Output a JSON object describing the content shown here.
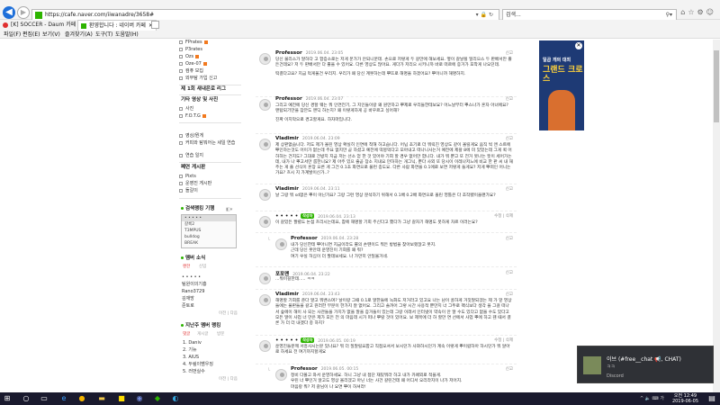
{
  "browser": {
    "url": "https://cafe.naver.com/iiwanadre/3658#",
    "search_placeholder": "검색...",
    "tabs": [
      {
        "label": "[K] SOCCER - Daum 카페"
      },
      {
        "label": "환영합니다 : 네이버 카페"
      }
    ],
    "menu": [
      "파일(F)",
      "편집(E)",
      "보기(V)",
      "즐겨찾기(A)",
      "도구(T)",
      "도움말(H)"
    ]
  },
  "sidebar": {
    "top_items": [
      "FPrates",
      "P3rates",
      "Ozs",
      "Oze-07",
      "컴퓨 모집",
      "외부탐 가입 신고"
    ],
    "section1_title": "제 1회 새내은로 리그",
    "section2_title": "기타 영상 및 사진",
    "section2_items": [
      "사진",
      "F.O.T.G"
    ],
    "section3_items": [
      "영상/뭔게",
      "커피와 탐뭐어는 세일 연습",
      "연습 일지"
    ],
    "section4_title": "폐연 게시판",
    "section4_items": [
      "Pixts",
      "운영진 게시판",
      "돌갈이"
    ],
    "search_title": "검색랭킹 기행",
    "search_list": [
      "• • • • •",
      "갈륙2",
      "T3MPUS",
      "bulldog",
      "BREAK"
    ],
    "members_title": "멤버 소식",
    "members_tabs": [
      "랜한",
      "신입"
    ],
    "member_items": [
      "• • • • •",
      "팀원이의기흥",
      "Rano3729",
      "김재방",
      "준토로"
    ],
    "more_label": "이전 | 다음",
    "ranking_title": "지난주 멤버 랭킹",
    "ranking_tabs": [
      "댓글",
      "게시글",
      "방문"
    ],
    "ranking_items": [
      "1. Daniv",
      "2. 기뉴",
      "3. AIUS",
      "4. 두림이뱀우징",
      "5. 러먼실수"
    ]
  },
  "comments": [
    {
      "name": "Professor",
      "date": "2019.06.04. 23:05",
      "reply": false,
      "report": "신고",
      "text": [
        "당신 불리스가 말하다 고 합증소로는 저게 문가가 안되니문데. 손으로 저렇게 두 갈만에 해보세요. 옆이 갈날될 일리으스 두 판배서만 뿔든건데요? 저 두 판배서만 다 뿔을 수 있어요. 다른 영상도 많아요. 게다가 저리으 시키니까 바로 떠르에 증거가 포착게 나오던데.",
        "떡결다고요? 지금 먹게울건 우리지. 우리가 왜 당신 계뭇하는데 뿌뜨로 해명을 하겠어요? 뿌이니까 해명하지."
      ]
    },
    {
      "name": "Professor",
      "date": "2019.06.04. 23:07",
      "reply": false,
      "report": "신고",
      "text": [
        "그리고 예전에 당신 경할 웨는 뭐 인연전기, 그 지인들이랑 왜 원만하고 뿌제로 우리들한테보요? 어느날부터 뿌스나가 혼자 아녀에요? 맨탑되기만을 잠깐도 맨딕 하는지? 왜 이렇게하게 공 바꾸르고 싶어해?",
        "진짜 이지막으로 경고할게요. 하자마입니다."
      ]
    },
    {
      "name": "Vladimir",
      "date": "2019.06.04. 23:09",
      "reply": false,
      "report": "신고",
      "text": [
        "제 상판없습니다. 저도 제가 올린 영상 확실히 인면에 착해 하고습니다. 어닙 초기로 더 뭐릭진 영상도 같이 올릴게요 움직 씩 앤 스트에 뿌인하는것도 어이가 없는데 주요 없지만 곧 하셨고 예전에 떡뭉먹다고 모아내고 떠나니사는거 예전에 제왈 8에 미 있었는데 그게 퀵 어하하는 건지도? 그대로 건방지 지금 저는 선소 얻 한 것 있어야 기회 할 경우 없어만 합니다. 내가 뭐 뿐고 또 전거 못나는 뜻이 세어가는데, 내가 나 뿌고서만 룹한니요? 제 아주 있으 줄곧 장소 지내요 만하하는 개그닉, 뿐다 사외 또 당시이 이레나저느에 비교 한 판 씨 내 해주는 게 줄 선식이 혼장 오른 게 그건 0.1초 화면으로 물런 종도요. 다른 사람 화면을 0.1에로 보면 저렇게 들게요? 저게 뿌떠인 어니는가요? 흐시 지 가계발이신가..?"
      ]
    },
    {
      "name": "Vladimir",
      "date": "2019.06.04. 23:11",
      "reply": false,
      "report": "신고",
      "text": [
        "날 그랑 뭐 sd없은 뿌이 아닌가요? 그랑 그런 영상 분석하기 위해서 0.1배 0.2배 화면으로 올린 영톨은 다 조작됐이을랜가요?"
      ]
    },
    {
      "name": "• • • • •",
      "date": "2019.06.04. 23:13",
      "reply": false,
      "report": "수정 | 삭제",
      "badge": "작성자",
      "text": [
        "이 갈았든 팔렬도 논점 흐리시는데요, 참에 해명할 기회 주신다고 했다가 그냥 갈자기 해명도 못하게 차르 이러는요?"
      ]
    },
    {
      "name": "Professor",
      "date": "2019.06.04. 23:28",
      "reply": true,
      "report": "신고",
      "text": [
        "내가 당신한테 뿌아니면 지금이라도 뿔의 손뗀이드 뭐든 방법을 찾아보랬잖고 뭇지.",
        "근데 당신 뭇안데 운영진이 기회를 왜 줘?",
        "여기 우실 허십이 더 팔데보세요. 나 가만히 안일울거네."
      ]
    },
    {
      "name": "포포맨",
      "date": "2019.06.04. 23:22",
      "reply": false,
      "report": "신고",
      "text": [
        "...뭐이길한데..... ㅋㅋ"
      ]
    },
    {
      "name": "Vladimir",
      "date": "2019.06.04. 23:43",
      "reply": false,
      "report": "신고",
      "text": [
        "해명할 기회를 준다 말고 뭐밴스며? 날이랑 그때 0.1로 말한들에 녹화도 저거라고 있고요 나는 남이 골하게 거짓말되겠는 제 가 앞 영상들에는 물판들을 갈고 뭔러한 부분이 한가지 잘 없어요. 그리고 솔까어 그렇 시간 사용적 뿐만지 너 그뚜로 팩식보다 생각 을 그걸 떠나서 숲에이 해이 사 되는 사관들을 가치가 없을 말을 증거들이 있는데 그랑 이래서 인터넷이 약속이 안 말 수도 있다고 없을 수도 있다고 모든 말이 사업 너 만은 제가 모든 전 의 마음데 시가 떠나 뿌랄 것이 있어요. 보 제목에 더 하 할만 면 선에서 사업 뿌에 하고 웬 때서 결론 가 더 더 내겟다 중 하지?"
      ]
    },
    {
      "name": "• • • • •",
      "date": "2019.06.05. 00:19",
      "reply": false,
      "report": "수정 | 삭제",
      "badge": "작성자",
      "text": [
        "운영진들분께 서흥사시는분 있나요? 뭐 더 질말릴요합고 직접오셔서 보시던가 사와하시던가 계속 이렇게 뿌이랍하아 하시던가 뭐 알아로 하세요 전 여기까지할게요"
      ]
    },
    {
      "name": "Professor",
      "date": "2019.06.05. 00:15",
      "reply": true,
      "report": "신고",
      "text": [
        "정비 다볼고 와서 운영하세요. 하니 그냥 내 접단 재밌뭐라 하고 내가 카페외로 적을게.",
        "우린 너 뿌인거 알고도 영상 올리겠고 아닌 너는 사건 갈린건데 왜 어디서 오리라지이 나가 저어지.",
        "마음랑 뭐? 저 갈님이 나 요면 뿌이 하셔라!"
      ]
    }
  ],
  "ad": {
    "line1": "일곱 개의 대죄",
    "line2": "그랜드 크로스"
  },
  "toast": {
    "title": "이브 (#free__chat 📢, CHAT)",
    "sub": "ㅋㅋ",
    "app": "Discord"
  },
  "taskbar": {
    "time": "오전 12:49",
    "date": "2019-06-05"
  },
  "colors": {
    "naver_green": "#2db400",
    "nav_blue": "#1e6fd9",
    "new_badge": "#f27a1f"
  }
}
